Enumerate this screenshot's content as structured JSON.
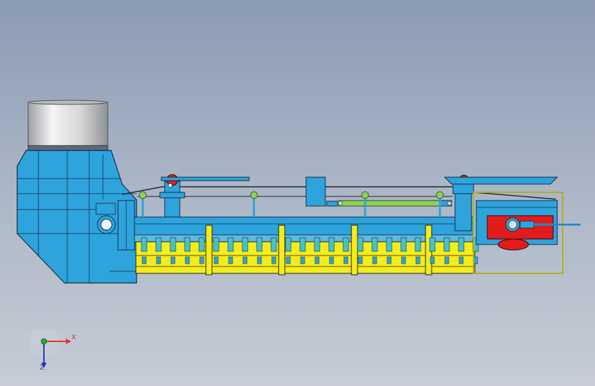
{
  "viewport": {
    "background": [
      "#8b9bb3",
      "#c7ccd6"
    ]
  },
  "model": {
    "name_icon": "conveyor-assembly-icon",
    "colors": {
      "body": "#2ea3dc",
      "frame_yellow": "#f5ec1a",
      "cylinder_green": "#8fcf5b",
      "drive_red": "#e21b1b",
      "hopper_steel": "#d9dadb"
    }
  },
  "triad": {
    "x_label": "X",
    "z_label": "Z",
    "x_color": "#e0352b",
    "y_color": "#1fae3a",
    "z_color": "#2237b8"
  }
}
